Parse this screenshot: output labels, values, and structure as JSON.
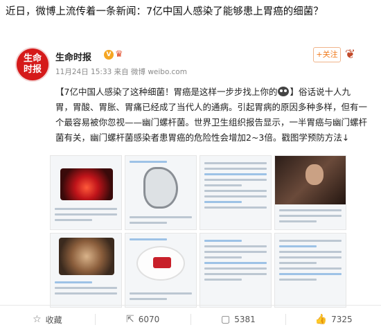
{
  "headline": "近日，微博上流传着一条新闻：7亿中国人感染了能够患上胃癌的细菌？",
  "account": {
    "avatar_text_line1": "生命",
    "avatar_text_line2": "时报",
    "name": "生命时报",
    "verified_badge": "V",
    "meta": "11月24日 15:33 来自 微博 weibo.com"
  },
  "follow_label": "+关注",
  "post": {
    "part1": "【7亿中国人感染了这种细菌！胃癌是这样一步步找上你的",
    "part2": "】俗话说十人九胃，胃酸、胃胀、胃痛已经成了当代人的通病。引起胃病的原因多种多样，但有一个最容易被你忽视——幽门螺杆菌。世界卫生组织报告显示，一半胃癌与幽门螺杆菌有关，幽门螺杆菌感染者患胃癌的危险性会增加2~3倍。戳图学预防方法↓"
  },
  "actions": {
    "favorite_label": "收藏",
    "repost_count": "6070",
    "comment_count": "5381",
    "like_count": "7325"
  },
  "icons": [
    "star-icon",
    "repost-icon",
    "comment-icon",
    "like-icon",
    "crown-icon",
    "more-icon"
  ]
}
